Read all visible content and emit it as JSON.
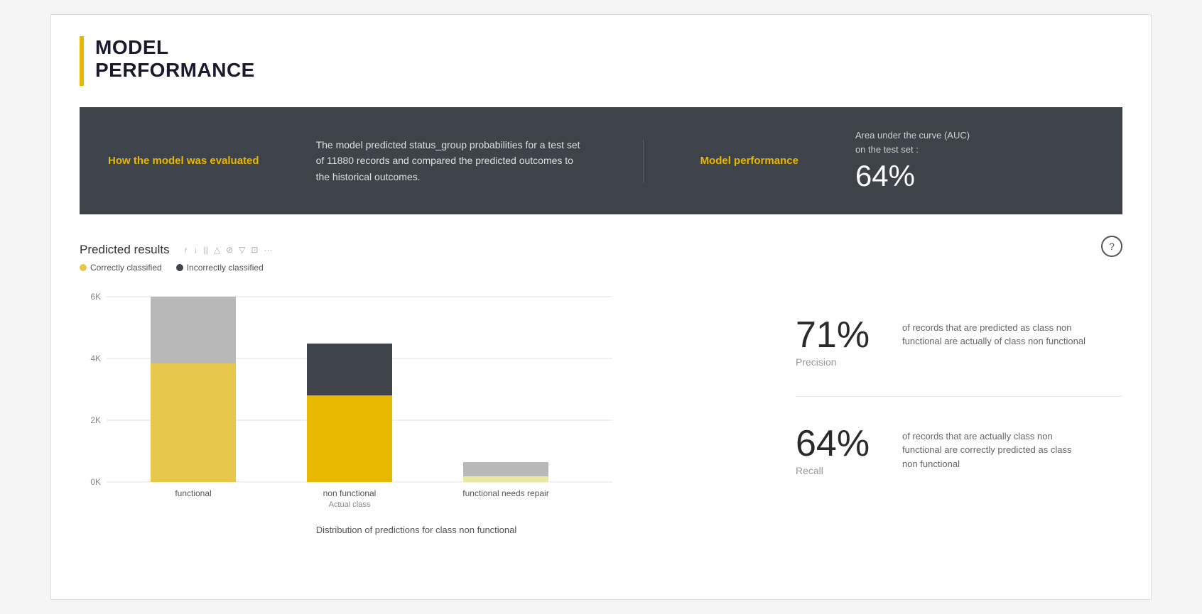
{
  "header": {
    "title_line1": "MODEL",
    "title_line2": "PERFORMANCE"
  },
  "banner": {
    "left_label": "How the model was evaluated",
    "description": "The model predicted status_group probabilities for a test set of 11880 records and compared the predicted outcomes to the historical outcomes.",
    "performance_label": "Model performance",
    "auc_label_line1": "Area under the curve (AUC)",
    "auc_label_line2": "on the test set :",
    "auc_value": "64%"
  },
  "chart": {
    "title": "Predicted results",
    "legend": {
      "correctly_label": "Correctly classified",
      "incorrectly_label": "Incorrectly classified"
    },
    "toolbar_icons": [
      "↑",
      "↓",
      "||",
      "△",
      "⊘",
      "▽",
      "⊡",
      "···"
    ],
    "y_axis_labels": [
      "6K",
      "4K",
      "2K",
      "0K"
    ],
    "x_axis_labels": [
      "functional",
      "non functional",
      "functional needs repair"
    ],
    "x_axis_sublabel": "Actual class",
    "footer": "Distribution of predictions for class non functional",
    "bars": {
      "functional": {
        "correctly": 4100,
        "incorrectly": 2300,
        "max": 6400
      },
      "non_functional": {
        "correctly": 3000,
        "incorrectly": 1800,
        "max": 4800
      },
      "functional_needs_repair": {
        "correctly": 180,
        "incorrectly": 500,
        "max": 680
      }
    }
  },
  "stats": {
    "precision": {
      "value": "71%",
      "label": "Precision",
      "description": "of records that are predicted as class non functional are actually of class non functional"
    },
    "recall": {
      "value": "64%",
      "label": "Recall",
      "description": "of records that are actually class non functional are correctly predicted as class non functional"
    }
  },
  "help_button_label": "?"
}
